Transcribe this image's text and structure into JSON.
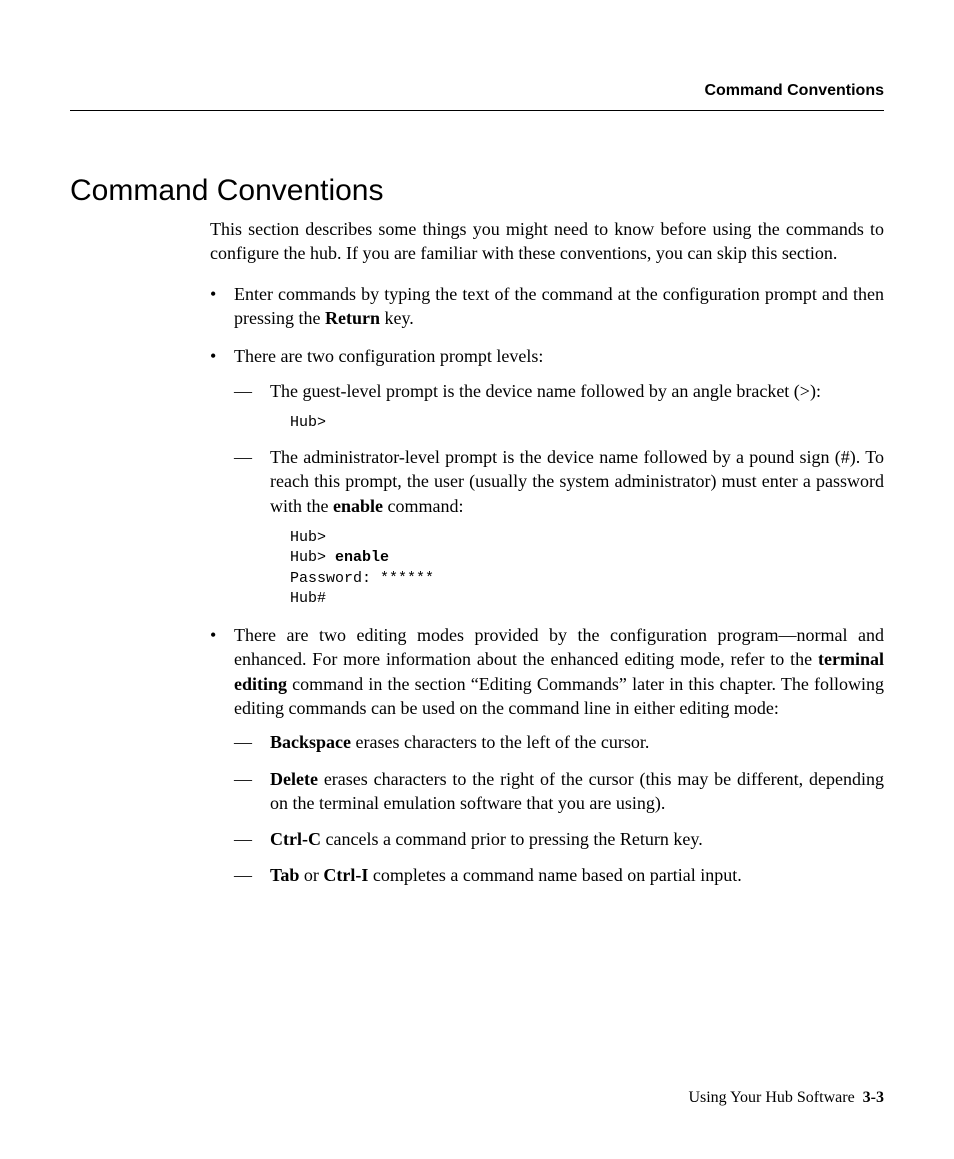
{
  "header": {
    "running_title": "Command Conventions"
  },
  "section": {
    "title": "Command Conventions",
    "intro": "This section describes some things you might need to know before using the commands to configure the hub. If you are familiar with these conventions, you can skip this section."
  },
  "bullets": {
    "b1_pre": "Enter commands by typing the text of the command at the configuration prompt and then pressing the ",
    "b1_bold": "Return",
    "b1_post": " key.",
    "b2": "There are two configuration prompt levels:",
    "b2_d1": "The guest-level prompt is the device name followed by an angle bracket (>):",
    "b2_d1_code": "Hub>",
    "b2_d2_pre": "The administrator-level prompt is the device name followed by a pound sign (#). To reach this prompt, the user (usually the system administrator) must enter a password with the ",
    "b2_d2_bold": "enable",
    "b2_d2_post": " command:",
    "b2_d2_code_l1": "Hub>",
    "b2_d2_code_l2a": "Hub> ",
    "b2_d2_code_l2b": "enable",
    "b2_d2_code_l3": "Password: ******",
    "b2_d2_code_l4": "Hub#",
    "b3_pre": "There are two editing modes provided by the configuration program—normal and enhanced. For more information about the enhanced editing mode, refer to the ",
    "b3_bold": "terminal editing",
    "b3_post": " command in the section “Editing Commands” later in this chapter. The following editing commands can be used on the command line in either editing mode:",
    "b3_d1_bold": "Backspace",
    "b3_d1_post": " erases characters to the left of the cursor.",
    "b3_d2_bold": "Delete",
    "b3_d2_post": " erases characters to the right of the cursor (this may be different, depending on the terminal emulation software that you are using).",
    "b3_d3_bold": "Ctrl-C",
    "b3_d3_post": " cancels a command prior to pressing the Return key.",
    "b3_d4_bold1": "Tab",
    "b3_d4_mid": " or ",
    "b3_d4_bold2": "Ctrl-I",
    "b3_d4_post": " completes a command name based on partial input."
  },
  "footer": {
    "book": "Using Your Hub Software",
    "page": "3-3"
  }
}
